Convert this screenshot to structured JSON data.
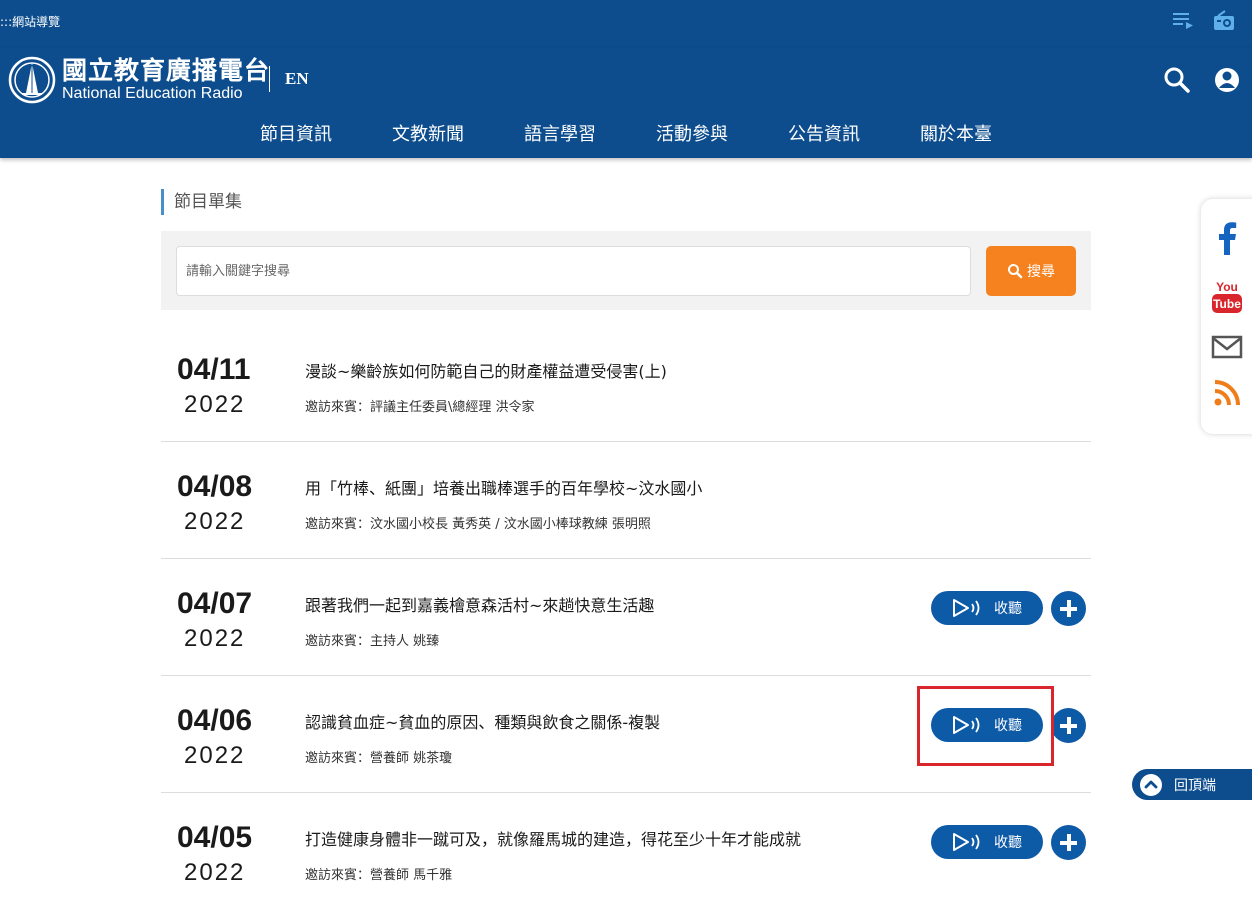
{
  "topbar": {
    "site_nav": ":::網站導覽",
    "icons": [
      "playlist-icon",
      "radio-icon"
    ]
  },
  "header": {
    "logo_zh": "國立教育廣播電台",
    "logo_en": "National Education Radio",
    "lang": "EN",
    "icons": [
      "search-icon",
      "user-icon"
    ]
  },
  "menu": {
    "items": [
      "節目資訊",
      "文教新聞",
      "語言學習",
      "活動參與",
      "公告資訊",
      "關於本臺"
    ]
  },
  "section": {
    "title": "節目單集"
  },
  "search": {
    "placeholder": "請輸入關鍵字搜尋",
    "button_label": "搜尋"
  },
  "episodes": [
    {
      "date": "04/11",
      "year": "2022",
      "title": "漫談~樂齡族如何防範自己的財產權益遭受侵害(上)",
      "guest": "邀訪來賓：評議主任委員\\總經理 洪令家",
      "has_listen": false
    },
    {
      "date": "04/08",
      "year": "2022",
      "title": "用「竹棒、紙團」培養出職棒選手的百年學校~汶水國小",
      "guest": "邀訪來賓：汶水國小校長 黃秀英 / 汶水國小棒球教練 張明照",
      "has_listen": false
    },
    {
      "date": "04/07",
      "year": "2022",
      "title": "跟著我們一起到嘉義檜意森活村~來趟快意生活趣",
      "guest": "邀訪來賓：主持人 姚臻",
      "has_listen": true
    },
    {
      "date": "04/06",
      "year": "2022",
      "title": "認識貧血症~貧血的原因、種類與飲食之關係-複製",
      "guest": "邀訪來賓：營養師 姚茶瓊",
      "has_listen": true
    },
    {
      "date": "04/05",
      "year": "2022",
      "title": "打造健康身體非一蹴可及，就像羅馬城的建造，得花至少十年才能成就",
      "guest": "邀訪來賓：營養師 馬千雅",
      "has_listen": true
    }
  ],
  "listen_label": "收聽",
  "social": {
    "icons": [
      "facebook-icon",
      "youtube-icon",
      "mail-icon",
      "rss-icon"
    ],
    "youtube_top": "You",
    "youtube_bottom": "Tube"
  },
  "back_to_top": "回頂端",
  "colors": {
    "brand_blue": "#0d4d8e",
    "button_blue": "#0d5aa7",
    "search_orange": "#f5821f",
    "highlight_red": "#d9262c"
  }
}
